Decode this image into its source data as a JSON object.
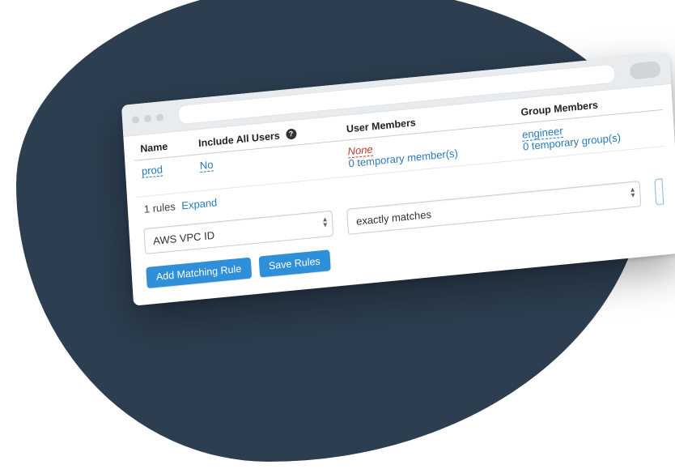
{
  "table": {
    "headers": {
      "name": "Name",
      "include": "Include All Users",
      "user_members": "User Members",
      "group_members": "Group Members"
    },
    "row": {
      "name": "prod",
      "include": "No",
      "um_none": "None",
      "um_temp": "0 temporary member(s)",
      "gm_group": "engineer",
      "gm_temp": "0 temporary group(s)"
    }
  },
  "rules_summary": {
    "text": "1 rules",
    "expand": "Expand"
  },
  "selects": {
    "field": "AWS VPC ID",
    "operator": "exactly matches"
  },
  "buttons": {
    "add": "Add Matching Rule",
    "save": "Save Rules"
  }
}
